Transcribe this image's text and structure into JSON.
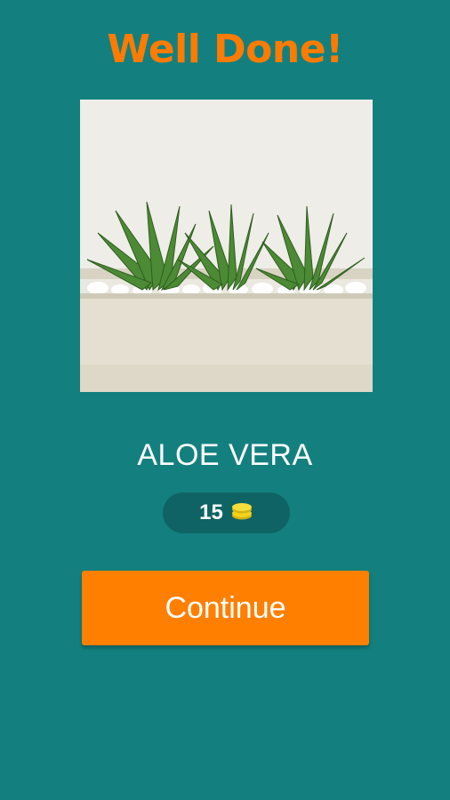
{
  "header": {
    "title": "Well Done!"
  },
  "answer": {
    "word": "ALOE VERA"
  },
  "reward": {
    "amount": "15",
    "icon": "coins-icon"
  },
  "actions": {
    "continue_label": "Continue"
  },
  "colors": {
    "background": "#13807f",
    "accent": "#ff7f00",
    "badge": "#0f6364",
    "coin": "#f2d21b"
  }
}
